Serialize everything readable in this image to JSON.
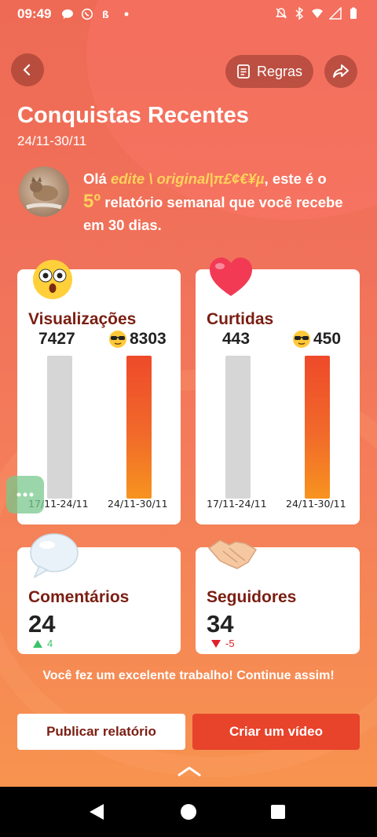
{
  "status_bar": {
    "time": "09:49"
  },
  "header": {
    "back_icon": "chevron-left-icon",
    "rules_label": "Regras",
    "share_icon": "share-icon"
  },
  "title": "Conquistas Recentes",
  "date_range": "24/11-30/11",
  "greeting": {
    "prefix": "Olá ",
    "username": "edite \\ original|π£¢€¥µ",
    "middle": ", este é o ",
    "report_number": "5º",
    "suffix": " relatório semanal que você recebe em 30 dias."
  },
  "cards": {
    "views": {
      "label": "Visualizações",
      "previous_value": "7427",
      "current_value": "8303",
      "previous_period": "17/11-24/11",
      "current_period": "24/11-30/11"
    },
    "likes": {
      "label": "Curtidas",
      "previous_value": "443",
      "current_value": "450",
      "previous_period": "17/11-24/11",
      "current_period": "24/11-30/11"
    },
    "comments": {
      "label": "Comentários",
      "value": "24",
      "delta": "4",
      "delta_direction": "up"
    },
    "followers": {
      "label": "Seguidores",
      "value": "34",
      "delta": "-5",
      "delta_direction": "down"
    }
  },
  "footer_message": "Você fez um excelente trabalho! Continue assim!",
  "buttons": {
    "publish": "Publicar relatório",
    "create_video": "Criar um vídeo"
  },
  "colors": {
    "accent": "#e8432b",
    "highlight": "#ffd25a",
    "label_dark_red": "#7a1e12",
    "up": "#3cc36a",
    "down": "#e0202a"
  }
}
